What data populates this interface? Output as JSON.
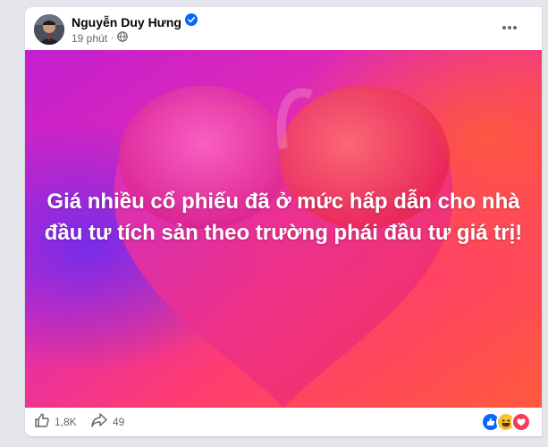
{
  "post": {
    "author": "Nguyễn Duy Hưng",
    "time": "19 phút",
    "separator": "·",
    "text": "Giá nhiều cổ phiếu đã ở mức hấp dẫn cho nhà đầu tư tích sản theo trường phái đầu tư giá trị!"
  },
  "footer": {
    "likes": "1,8K",
    "shares": "49"
  },
  "icons": {
    "verified": "verified-badge-icon",
    "privacy": "globe-icon",
    "more": "more-options-icon",
    "like": "thumbs-up-icon",
    "share": "share-arrow-icon",
    "reactions": [
      "like-reaction-icon",
      "haha-reaction-icon",
      "love-reaction-icon"
    ]
  },
  "colors": {
    "accent": "#0866ff",
    "background_gradient": [
      "#d62bb0",
      "#ff4f4f",
      "#8b2be2"
    ]
  }
}
